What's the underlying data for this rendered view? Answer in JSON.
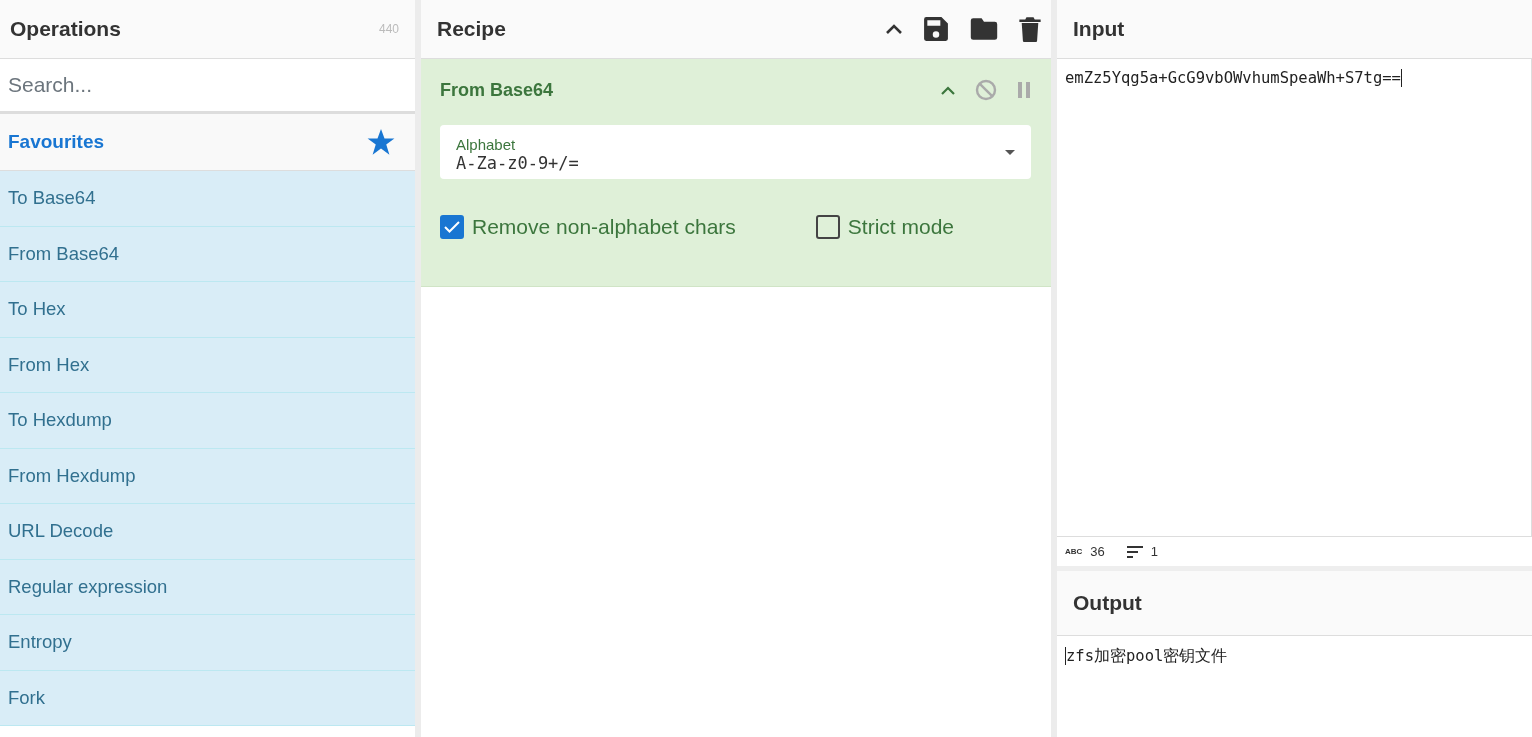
{
  "operations": {
    "title": "Operations",
    "count": "440",
    "search": {
      "placeholder": "Search..."
    },
    "category": "Favourites",
    "items": [
      {
        "label": "To Base64"
      },
      {
        "label": "From Base64"
      },
      {
        "label": "To Hex"
      },
      {
        "label": "From Hex"
      },
      {
        "label": "To Hexdump"
      },
      {
        "label": "From Hexdump"
      },
      {
        "label": "URL Decode"
      },
      {
        "label": "Regular expression"
      },
      {
        "label": "Entropy"
      },
      {
        "label": "Fork"
      }
    ]
  },
  "recipe": {
    "title": "Recipe",
    "operation": {
      "name": "From Base64",
      "disabled": false,
      "breakpoint": false,
      "alphabet": {
        "label": "Alphabet",
        "value": "A-Za-z0-9+/="
      },
      "options": [
        {
          "label": "Remove non-alphabet chars",
          "checked": true
        },
        {
          "label": "Strict mode",
          "checked": false
        }
      ]
    }
  },
  "input": {
    "title": "Input",
    "value": "emZz5Yqg5a+GcG9vbOWvhumSpeaWh+S7tg==",
    "status": {
      "length_label": "ABC",
      "length": "36",
      "lines": "1"
    }
  },
  "output": {
    "title": "Output",
    "value": "zfs加密pool密钥文件"
  }
}
